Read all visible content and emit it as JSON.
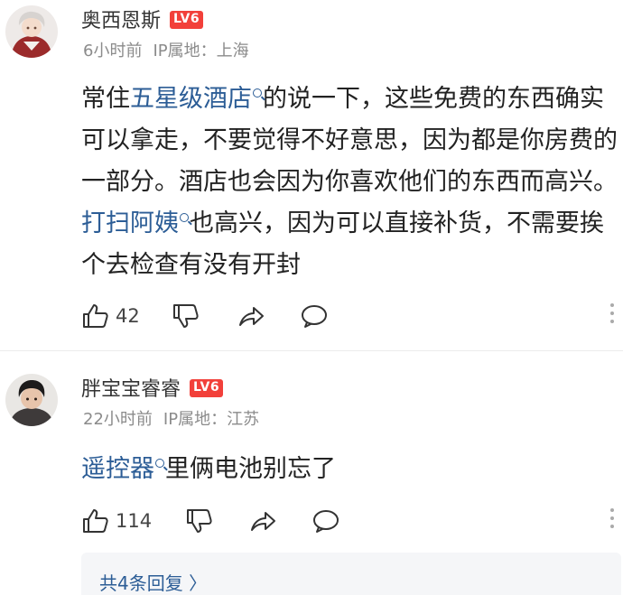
{
  "comments": [
    {
      "username": "奥西恩斯",
      "level": "LV6",
      "time": "6小时前",
      "ip": "IP属地：上海",
      "segments": [
        {
          "text": "常住",
          "link": false
        },
        {
          "text": "五星级酒店",
          "link": true
        },
        {
          "text": "的说一下，这些免费的东西确实可以拿走，不要觉得不好意思，因为都是你房费的一部分。酒店也会因为你喜欢他们的东西而高兴。",
          "link": false
        },
        {
          "text": "打扫阿姨",
          "link": true
        },
        {
          "text": "也高兴，因为可以直接补货，不需要挨个去检查有没有开封",
          "link": false
        }
      ],
      "like_count": "42"
    },
    {
      "username": "胖宝宝睿睿",
      "level": "LV6",
      "time": "22小时前",
      "ip": "IP属地：江苏",
      "segments": [
        {
          "text": "遥控器",
          "link": true
        },
        {
          "text": "里俩电池别忘了",
          "link": false
        }
      ],
      "like_count": "114",
      "replies_label": "共4条回复 〉"
    }
  ],
  "icons": {
    "like": "thumbs-up-icon",
    "dislike": "thumbs-down-icon",
    "share": "share-icon",
    "comment": "comment-bubble-icon",
    "more": "more-vertical-icon",
    "search": "search-icon"
  },
  "colors": {
    "link": "#2c5d96",
    "level_badge": "#f2403a",
    "meta": "#8b8b8b"
  }
}
